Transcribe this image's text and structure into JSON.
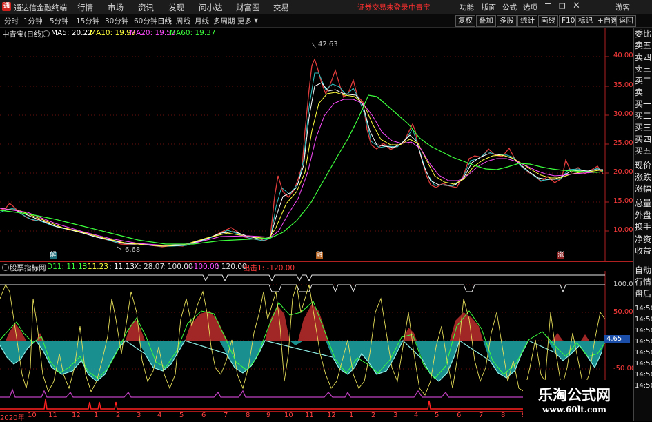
{
  "window": {
    "app_title": "通达信金融终端",
    "menus": [
      "行情",
      "市场",
      "资讯",
      "发现",
      "问小达",
      "财富圈",
      "交易"
    ],
    "login_notice": "证券交易未登录",
    "stock_name_title": "中青宝",
    "right_menus": [
      "功能",
      "版面",
      "公式",
      "选项"
    ],
    "user": "游客"
  },
  "toolbar": {
    "periods": [
      "分时",
      "1分钟",
      "5分钟",
      "15分钟",
      "30分钟",
      "60分钟",
      "日线",
      "周线",
      "月线",
      "多周期",
      "更多"
    ],
    "active_period": "日线",
    "right_buttons": [
      "复权",
      "叠加",
      "多股",
      "统计",
      "画线",
      "F10",
      "标记",
      "+自选",
      "返回"
    ]
  },
  "main_chart": {
    "stock": "中青宝(日线)",
    "ma": [
      {
        "label": "MA5: 20.22",
        "color": "#ffffff"
      },
      {
        "label": "MA10: 19.99",
        "color": "#ffff3c"
      },
      {
        "label": "MA20: 19.53",
        "color": "#ff4cff"
      },
      {
        "label": "MA60: 19.37",
        "color": "#3cff3c"
      }
    ],
    "price_axis": [
      "40.00",
      "35.00",
      "30.00",
      "25.00",
      "20.00",
      "15.00",
      "10.00"
    ],
    "high_label": "42.63",
    "low_label": "6.68",
    "markers": [
      "解",
      "融",
      "涨"
    ]
  },
  "indicator": {
    "name": "股票指标网",
    "values": [
      "D11: 11.13",
      ": 11.23",
      ": 11.13",
      "X: 28.07",
      ": 100.00",
      ": -100.00",
      ": 120.00",
      "出击1: -120.00"
    ],
    "axis": [
      "100.0",
      "50.00",
      "-50.00"
    ],
    "current": "4.65"
  },
  "date_axis": [
    "2020年",
    "10",
    "11",
    "12",
    "1",
    "2",
    "3",
    "4",
    "5",
    "6",
    "7",
    "8",
    "9",
    "10",
    "11",
    "12",
    "1",
    "2",
    "3",
    "4",
    "5",
    "6",
    "7",
    "8",
    "9"
  ],
  "right_panel": {
    "items": [
      "委比",
      "卖五",
      "卖四",
      "卖三",
      "卖二",
      "卖一",
      "买一",
      "买二",
      "买三",
      "买四",
      "买五",
      "现价",
      "涨跌",
      "涨幅",
      "总量",
      "外盘",
      "换手",
      "净资",
      "收益",
      "自动",
      "行情",
      "盘后",
      "14:56",
      "14:56",
      "14:56",
      "14:56",
      "14:56",
      "14:56",
      "14:56",
      "14:56"
    ]
  },
  "watermark": {
    "brand": "乐淘公式网",
    "url": "www.60lt.com"
  }
}
